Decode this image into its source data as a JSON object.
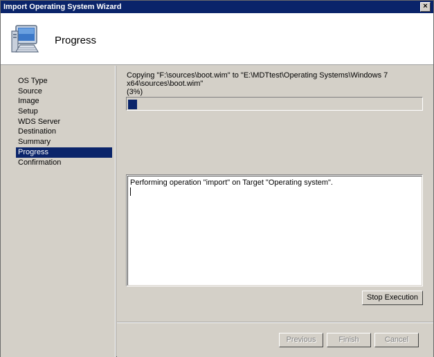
{
  "window": {
    "title": "Import Operating System Wizard",
    "close_glyph": "×"
  },
  "header": {
    "title": "Progress",
    "icon": "computer-icon"
  },
  "sidebar": {
    "items": [
      {
        "label": "OS Type",
        "active": false
      },
      {
        "label": "Source",
        "active": false
      },
      {
        "label": "Image",
        "active": false
      },
      {
        "label": "Setup",
        "active": false
      },
      {
        "label": "WDS Server",
        "active": false
      },
      {
        "label": "Destination",
        "active": false
      },
      {
        "label": "Summary",
        "active": false
      },
      {
        "label": "Progress",
        "active": true
      },
      {
        "label": "Confirmation",
        "active": false
      }
    ]
  },
  "main": {
    "status_line1": "Copying \"F:\\sources\\boot.wim\" to \"E:\\MDTtest\\Operating Systems\\Windows 7 x64\\sources\\boot.wim\"",
    "status_line2": "(3%)",
    "progress_fraction": 0.03,
    "log_text": "Performing operation \"import\" on Target \"Operating system\".",
    "stop_label": "Stop Execution"
  },
  "footer": {
    "previous_label": "Previous",
    "finish_label": "Finish",
    "cancel_label": "Cancel"
  },
  "colors": {
    "accent": "#0a246a",
    "face": "#d4d0c8"
  }
}
